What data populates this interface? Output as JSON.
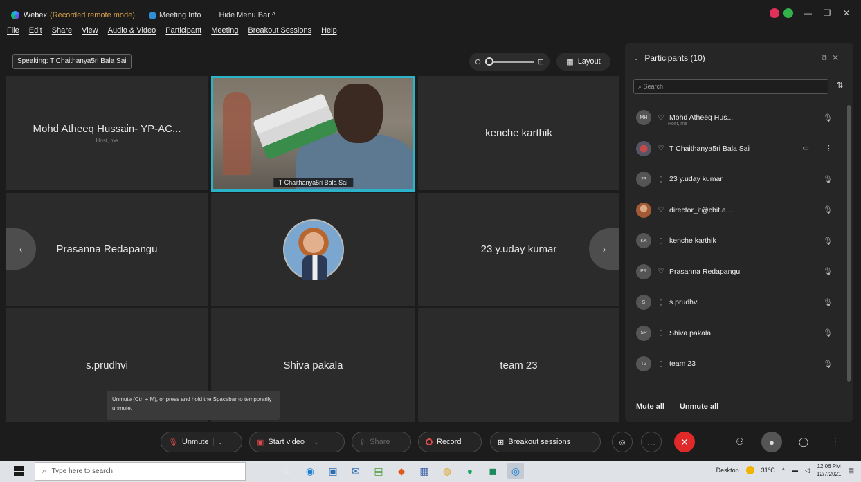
{
  "titlebar": {
    "app_title": "Webex",
    "recording_label": "(Recorded remote mode)",
    "meeting_info": "Meeting Info",
    "hide_menu": "Hide Menu Bar ^"
  },
  "menu": [
    "File",
    "Edit",
    "Share",
    "View",
    "Audio & Video",
    "Participant",
    "Meeting",
    "Breakout Sessions",
    "Help"
  ],
  "speaking": "Speaking: T Chaithanya5ri Bala Sai",
  "layout_label": "Layout",
  "grid": {
    "tiles": [
      {
        "name": "Mohd Atheeq Hussain- YP-AC...",
        "sub": "Host, me"
      },
      {
        "name": "T Chaithanya5ri Bala Sai",
        "video": true
      },
      {
        "name": "kenche karthik"
      },
      {
        "name": "Prasanna Redapangu"
      },
      {
        "name": "",
        "photo": true
      },
      {
        "name": "23 y.uday kumar"
      },
      {
        "name": "s.prudhvi"
      },
      {
        "name": "Shiva pakala"
      },
      {
        "name": "team 23"
      }
    ]
  },
  "tooltip": "Unmute (Ctrl + M), or press and hold the Spacebar to temporarily unmute.",
  "participants": {
    "title": "Participants (10)",
    "search_placeholder": "Search",
    "items": [
      {
        "initials": "MH",
        "name": "Mohd Atheeq Hus...",
        "sub": "Host, me"
      },
      {
        "initials": "",
        "name": "T Chaithanya5ri Bala Sai",
        "video": true
      },
      {
        "initials": "23",
        "name": "23 y.uday kumar"
      },
      {
        "initials": "",
        "name": "director_it@cbit.a..."
      },
      {
        "initials": "KK",
        "name": "kenche karthik"
      },
      {
        "initials": "PR",
        "name": "Prasanna Redapangu"
      },
      {
        "initials": "S",
        "name": "s.prudhvi"
      },
      {
        "initials": "SP",
        "name": "Shiva pakala"
      },
      {
        "initials": "T2",
        "name": "team 23"
      }
    ],
    "mute_all": "Mute all",
    "unmute_all": "Unmute all"
  },
  "controls": {
    "unmute": "Unmute",
    "start_video": "Start video",
    "share": "Share",
    "record": "Record",
    "breakout": "Breakout sessions"
  },
  "taskbar": {
    "search_placeholder": "Type here to search",
    "desktop": "Desktop",
    "temperature": "31°C",
    "time": "12:06 PM",
    "date": "12/7/2021"
  }
}
